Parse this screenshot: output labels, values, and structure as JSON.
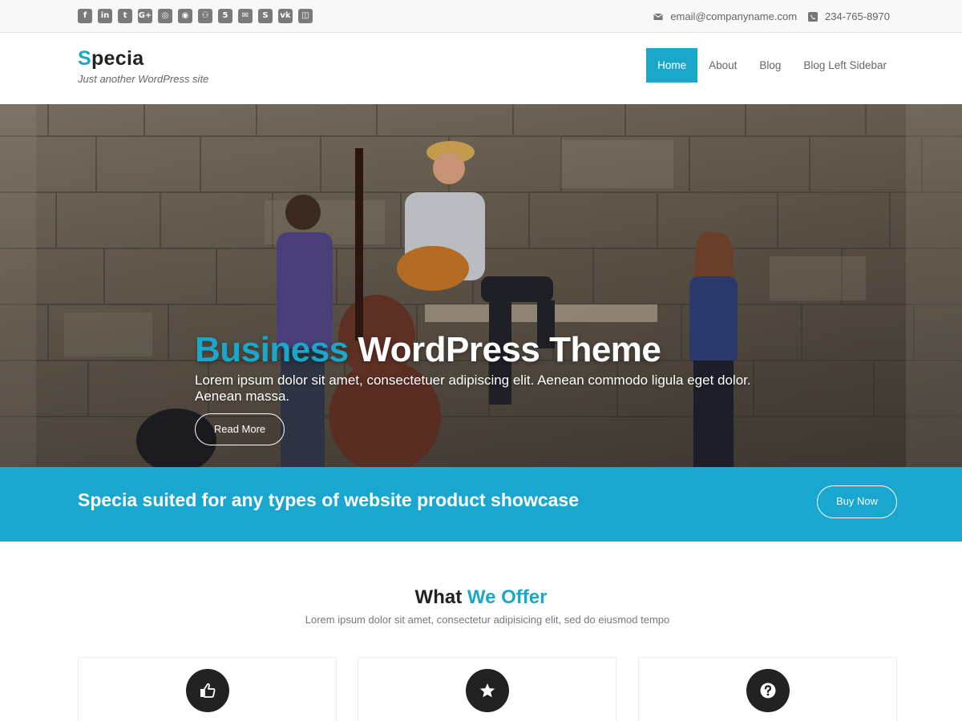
{
  "topbar": {
    "social_icons": [
      "facebook-icon",
      "linkedin-icon",
      "twitter-icon",
      "google-plus-icon",
      "instagram-icon",
      "dribbble-icon",
      "github-icon",
      "html5-icon",
      "email-icon",
      "skype-icon",
      "vk-icon",
      "foursquare-icon"
    ],
    "social_glyphs": [
      "f",
      "in",
      "t",
      "G+",
      "◎",
      "◉",
      "⚇",
      "5",
      "✉",
      "S",
      "vk",
      "◫"
    ],
    "email": "email@companyname.com",
    "phone": "234-765-8970"
  },
  "header": {
    "logo_first": "S",
    "logo_rest": "pecia",
    "tagline": "Just another WordPress site",
    "nav": [
      "Home",
      "About",
      "Blog",
      "Blog Left Sidebar"
    ],
    "active_nav": "Home"
  },
  "hero": {
    "title_highlight": "Business",
    "title_rest": " WordPress Theme",
    "text": "Lorem ipsum dolor sit amet, consectetuer adipiscing elit. Aenean commodo ligula eget dolor. Aenean massa.",
    "button": "Read More"
  },
  "cta": {
    "text": "Specia suited for any types of website product showcase",
    "button": "Buy Now"
  },
  "offer": {
    "title_first": "What ",
    "title_highlight": "We Offer",
    "subtitle": "Lorem ipsum dolor sit amet, consectetur adipisicing elit, sed do eiusmod tempo",
    "cards": [
      {
        "icon": "thumbs-up-icon"
      },
      {
        "icon": "star-icon"
      },
      {
        "icon": "question-icon"
      }
    ]
  },
  "colors": {
    "accent": "#1aa7c9",
    "cta_bg": "#1aa7cf",
    "topbar_bg": "#f8f8f8"
  }
}
